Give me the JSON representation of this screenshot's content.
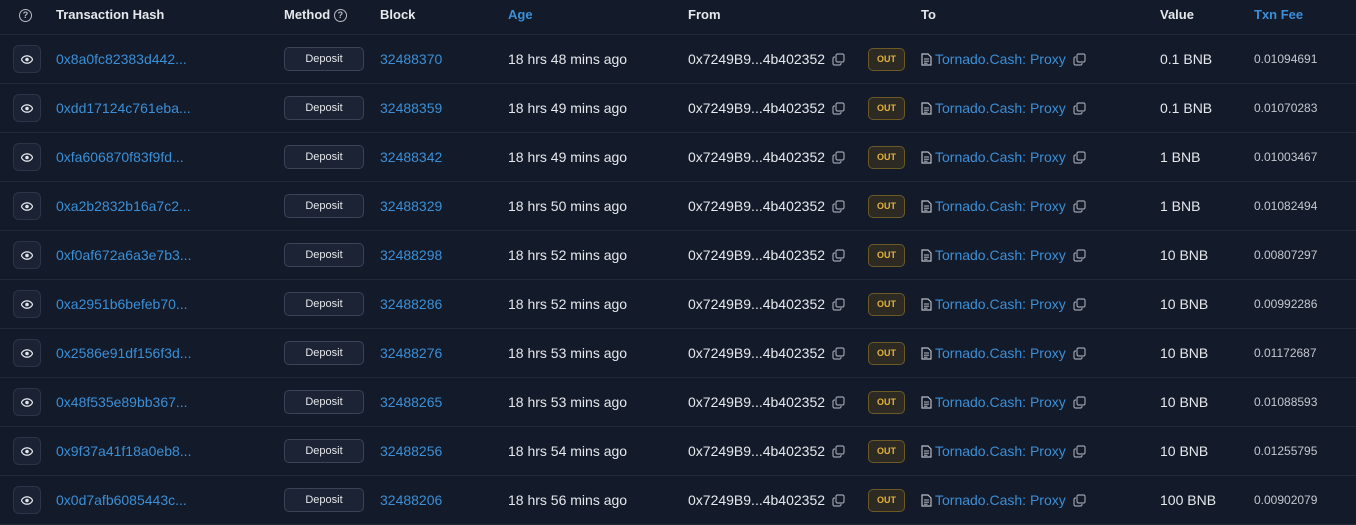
{
  "header": {
    "transaction_hash": "Transaction Hash",
    "method": "Method",
    "block": "Block",
    "age": "Age",
    "from": "From",
    "to": "To",
    "value": "Value",
    "txn_fee": "Txn Fee"
  },
  "out_label": "OUT",
  "rows": [
    {
      "hash": "0x8a0fc82383d442...",
      "method": "Deposit",
      "block": "32488370",
      "age": "18 hrs 48 mins ago",
      "from": "0x7249B9...4b402352",
      "to": "Tornado.Cash: Proxy",
      "value": "0.1 BNB",
      "fee": "0.01094691"
    },
    {
      "hash": "0xdd17124c761eba...",
      "method": "Deposit",
      "block": "32488359",
      "age": "18 hrs 49 mins ago",
      "from": "0x7249B9...4b402352",
      "to": "Tornado.Cash: Proxy",
      "value": "0.1 BNB",
      "fee": "0.01070283"
    },
    {
      "hash": "0xfa606870f83f9fd...",
      "method": "Deposit",
      "block": "32488342",
      "age": "18 hrs 49 mins ago",
      "from": "0x7249B9...4b402352",
      "to": "Tornado.Cash: Proxy",
      "value": "1 BNB",
      "fee": "0.01003467"
    },
    {
      "hash": "0xa2b2832b16a7c2...",
      "method": "Deposit",
      "block": "32488329",
      "age": "18 hrs 50 mins ago",
      "from": "0x7249B9...4b402352",
      "to": "Tornado.Cash: Proxy",
      "value": "1 BNB",
      "fee": "0.01082494"
    },
    {
      "hash": "0xf0af672a6a3e7b3...",
      "method": "Deposit",
      "block": "32488298",
      "age": "18 hrs 52 mins ago",
      "from": "0x7249B9...4b402352",
      "to": "Tornado.Cash: Proxy",
      "value": "10 BNB",
      "fee": "0.00807297"
    },
    {
      "hash": "0xa2951b6befeb70...",
      "method": "Deposit",
      "block": "32488286",
      "age": "18 hrs 52 mins ago",
      "from": "0x7249B9...4b402352",
      "to": "Tornado.Cash: Proxy",
      "value": "10 BNB",
      "fee": "0.00992286"
    },
    {
      "hash": "0x2586e91df156f3d...",
      "method": "Deposit",
      "block": "32488276",
      "age": "18 hrs 53 mins ago",
      "from": "0x7249B9...4b402352",
      "to": "Tornado.Cash: Proxy",
      "value": "10 BNB",
      "fee": "0.01172687"
    },
    {
      "hash": "0x48f535e89bb367...",
      "method": "Deposit",
      "block": "32488265",
      "age": "18 hrs 53 mins ago",
      "from": "0x7249B9...4b402352",
      "to": "Tornado.Cash: Proxy",
      "value": "10 BNB",
      "fee": "0.01088593"
    },
    {
      "hash": "0x9f37a41f18a0eb8...",
      "method": "Deposit",
      "block": "32488256",
      "age": "18 hrs 54 mins ago",
      "from": "0x7249B9...4b402352",
      "to": "Tornado.Cash: Proxy",
      "value": "10 BNB",
      "fee": "0.01255795"
    },
    {
      "hash": "0x0d7afb6085443c...",
      "method": "Deposit",
      "block": "32488206",
      "age": "18 hrs 56 mins ago",
      "from": "0x7249B9...4b402352",
      "to": "Tornado.Cash: Proxy",
      "value": "100 BNB",
      "fee": "0.00902079"
    }
  ],
  "colors": {
    "background": "#131a2a",
    "link": "#3b8fd6",
    "out_badge_text": "#e3b33a"
  }
}
